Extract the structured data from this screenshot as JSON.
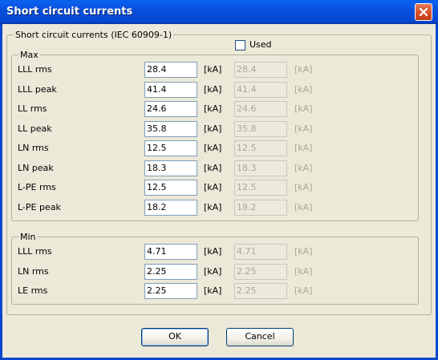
{
  "window": {
    "title": "Short circuit currents",
    "close_icon": "close-icon"
  },
  "main_group": {
    "legend": "Short circuit currents (IEC 60909-1)"
  },
  "used_checkbox": {
    "label": "Used",
    "checked": false
  },
  "max_group": {
    "legend": "Max",
    "rows": [
      {
        "label": "LLL rms",
        "value": "28.4",
        "unit": "[kA]",
        "used_value": "28.4",
        "used_unit": "[kA]"
      },
      {
        "label": "LLL peak",
        "value": "41.4",
        "unit": "[kA]",
        "used_value": "41.4",
        "used_unit": "[kA]"
      },
      {
        "label": "LL rms",
        "value": "24.6",
        "unit": "[kA]",
        "used_value": "24.6",
        "used_unit": "[kA]"
      },
      {
        "label": "LL peak",
        "value": "35.8",
        "unit": "[kA]",
        "used_value": "35.8",
        "used_unit": "[kA]"
      },
      {
        "label": "LN rms",
        "value": "12.5",
        "unit": "[kA]",
        "used_value": "12.5",
        "used_unit": "[kA]"
      },
      {
        "label": "LN peak",
        "value": "18.3",
        "unit": "[kA]",
        "used_value": "18.3",
        "used_unit": "[kA]"
      },
      {
        "label": "L-PE rms",
        "value": "12.5",
        "unit": "[kA]",
        "used_value": "12.5",
        "used_unit": "[kA]"
      },
      {
        "label": "L-PE peak",
        "value": "18.2",
        "unit": "[kA]",
        "used_value": "18.2",
        "used_unit": "[kA]"
      }
    ]
  },
  "min_group": {
    "legend": "Min",
    "rows": [
      {
        "label": "LLL rms",
        "value": "4.71",
        "unit": "[kA]",
        "used_value": "4.71",
        "used_unit": "[kA]"
      },
      {
        "label": "LN rms",
        "value": "2.25",
        "unit": "[kA]",
        "used_value": "2.25",
        "used_unit": "[kA]"
      },
      {
        "label": "LE rms",
        "value": "2.25",
        "unit": "[kA]",
        "used_value": "2.25",
        "used_unit": "[kA]"
      }
    ]
  },
  "buttons": {
    "ok": "OK",
    "cancel": "Cancel"
  }
}
